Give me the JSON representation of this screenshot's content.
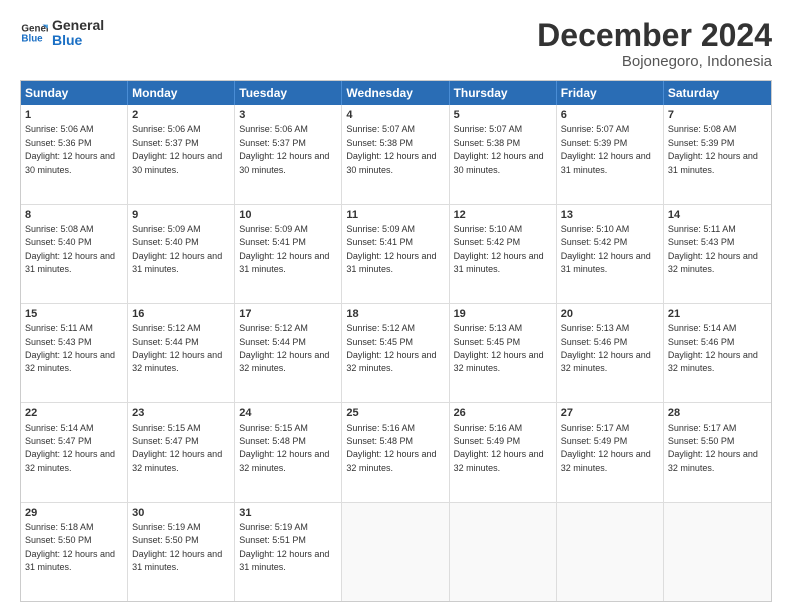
{
  "logo": {
    "line1": "General",
    "line2": "Blue"
  },
  "title": "December 2024",
  "subtitle": "Bojonegoro, Indonesia",
  "days_of_week": [
    "Sunday",
    "Monday",
    "Tuesday",
    "Wednesday",
    "Thursday",
    "Friday",
    "Saturday"
  ],
  "weeks": [
    [
      {
        "day": 1,
        "rise": "5:06 AM",
        "set": "5:36 PM",
        "dl": "12 hours and 30 minutes"
      },
      {
        "day": 2,
        "rise": "5:06 AM",
        "set": "5:37 PM",
        "dl": "12 hours and 30 minutes"
      },
      {
        "day": 3,
        "rise": "5:06 AM",
        "set": "5:37 PM",
        "dl": "12 hours and 30 minutes"
      },
      {
        "day": 4,
        "rise": "5:07 AM",
        "set": "5:38 PM",
        "dl": "12 hours and 30 minutes"
      },
      {
        "day": 5,
        "rise": "5:07 AM",
        "set": "5:38 PM",
        "dl": "12 hours and 30 minutes"
      },
      {
        "day": 6,
        "rise": "5:07 AM",
        "set": "5:39 PM",
        "dl": "12 hours and 31 minutes"
      },
      {
        "day": 7,
        "rise": "5:08 AM",
        "set": "5:39 PM",
        "dl": "12 hours and 31 minutes"
      }
    ],
    [
      {
        "day": 8,
        "rise": "5:08 AM",
        "set": "5:40 PM",
        "dl": "12 hours and 31 minutes"
      },
      {
        "day": 9,
        "rise": "5:09 AM",
        "set": "5:40 PM",
        "dl": "12 hours and 31 minutes"
      },
      {
        "day": 10,
        "rise": "5:09 AM",
        "set": "5:41 PM",
        "dl": "12 hours and 31 minutes"
      },
      {
        "day": 11,
        "rise": "5:09 AM",
        "set": "5:41 PM",
        "dl": "12 hours and 31 minutes"
      },
      {
        "day": 12,
        "rise": "5:10 AM",
        "set": "5:42 PM",
        "dl": "12 hours and 31 minutes"
      },
      {
        "day": 13,
        "rise": "5:10 AM",
        "set": "5:42 PM",
        "dl": "12 hours and 31 minutes"
      },
      {
        "day": 14,
        "rise": "5:11 AM",
        "set": "5:43 PM",
        "dl": "12 hours and 32 minutes"
      }
    ],
    [
      {
        "day": 15,
        "rise": "5:11 AM",
        "set": "5:43 PM",
        "dl": "12 hours and 32 minutes"
      },
      {
        "day": 16,
        "rise": "5:12 AM",
        "set": "5:44 PM",
        "dl": "12 hours and 32 minutes"
      },
      {
        "day": 17,
        "rise": "5:12 AM",
        "set": "5:44 PM",
        "dl": "12 hours and 32 minutes"
      },
      {
        "day": 18,
        "rise": "5:12 AM",
        "set": "5:45 PM",
        "dl": "12 hours and 32 minutes"
      },
      {
        "day": 19,
        "rise": "5:13 AM",
        "set": "5:45 PM",
        "dl": "12 hours and 32 minutes"
      },
      {
        "day": 20,
        "rise": "5:13 AM",
        "set": "5:46 PM",
        "dl": "12 hours and 32 minutes"
      },
      {
        "day": 21,
        "rise": "5:14 AM",
        "set": "5:46 PM",
        "dl": "12 hours and 32 minutes"
      }
    ],
    [
      {
        "day": 22,
        "rise": "5:14 AM",
        "set": "5:47 PM",
        "dl": "12 hours and 32 minutes"
      },
      {
        "day": 23,
        "rise": "5:15 AM",
        "set": "5:47 PM",
        "dl": "12 hours and 32 minutes"
      },
      {
        "day": 24,
        "rise": "5:15 AM",
        "set": "5:48 PM",
        "dl": "12 hours and 32 minutes"
      },
      {
        "day": 25,
        "rise": "5:16 AM",
        "set": "5:48 PM",
        "dl": "12 hours and 32 minutes"
      },
      {
        "day": 26,
        "rise": "5:16 AM",
        "set": "5:49 PM",
        "dl": "12 hours and 32 minutes"
      },
      {
        "day": 27,
        "rise": "5:17 AM",
        "set": "5:49 PM",
        "dl": "12 hours and 32 minutes"
      },
      {
        "day": 28,
        "rise": "5:17 AM",
        "set": "5:50 PM",
        "dl": "12 hours and 32 minutes"
      }
    ],
    [
      {
        "day": 29,
        "rise": "5:18 AM",
        "set": "5:50 PM",
        "dl": "12 hours and 31 minutes"
      },
      {
        "day": 30,
        "rise": "5:19 AM",
        "set": "5:50 PM",
        "dl": "12 hours and 31 minutes"
      },
      {
        "day": 31,
        "rise": "5:19 AM",
        "set": "5:51 PM",
        "dl": "12 hours and 31 minutes"
      },
      null,
      null,
      null,
      null
    ]
  ]
}
